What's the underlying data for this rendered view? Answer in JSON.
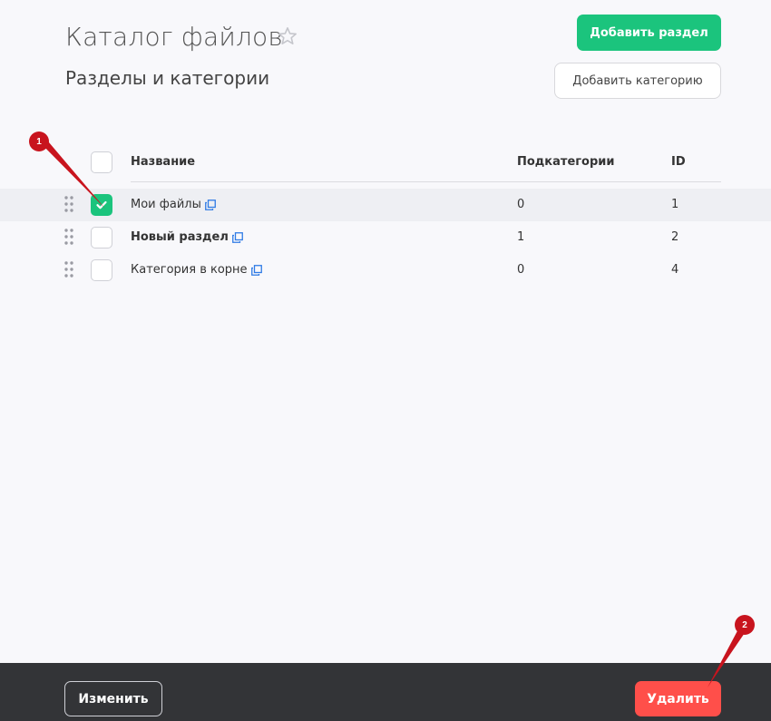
{
  "header": {
    "title": "Каталог файлов",
    "subtitle": "Разделы и категории",
    "star_icon": "star-outline-icon",
    "add_section_label": "Добавить раздел",
    "add_category_label": "Добавить категорию"
  },
  "table": {
    "columns": [
      "Название",
      "Подкатегории",
      "ID"
    ],
    "rows": [
      {
        "name": "Мои файлы",
        "subcategories": "0",
        "id": "1",
        "checked": true,
        "bold": false
      },
      {
        "name": "Новый раздел",
        "subcategories": "1",
        "id": "2",
        "checked": false,
        "bold": true
      },
      {
        "name": "Категория в корне",
        "subcategories": "0",
        "id": "4",
        "checked": false,
        "bold": false
      }
    ]
  },
  "footer": {
    "edit_label": "Изменить",
    "delete_label": "Удалить"
  },
  "annotations": {
    "marker_1": "1",
    "marker_2": "2"
  },
  "colors": {
    "accent": "#1bc47d",
    "danger": "#ff4f4a",
    "footer_bg": "#333437",
    "marker": "#c8141e",
    "link": "#2f7be5"
  }
}
